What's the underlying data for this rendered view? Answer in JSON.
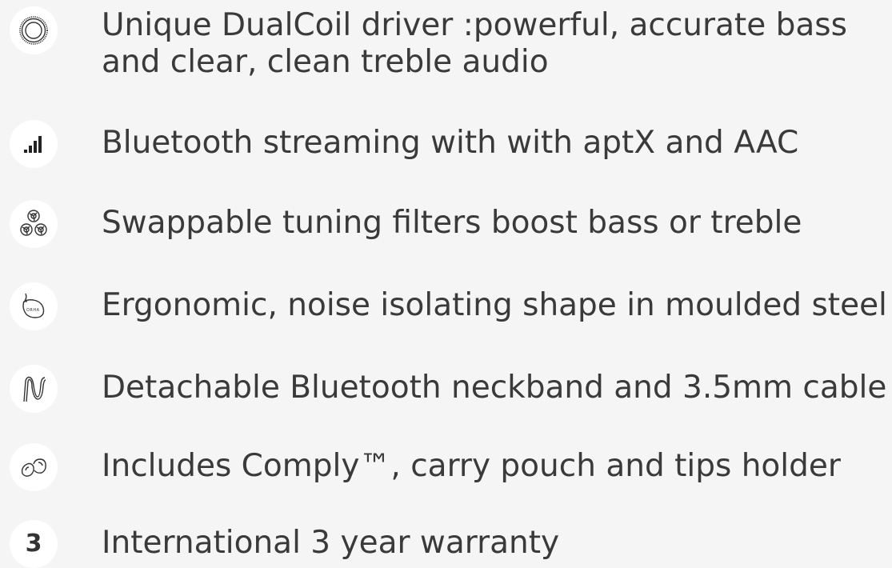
{
  "features": [
    {
      "icon": "driver-coil-icon",
      "text": "Unique DualCoil driver :powerful, accurate bass",
      "text2": "and clear, clean treble audio"
    },
    {
      "icon": "signal-bars-icon",
      "text": "Bluetooth streaming with with aptX and AAC"
    },
    {
      "icon": "tuning-filters-icon",
      "text": "Swappable tuning filters boost bass or treble"
    },
    {
      "icon": "earbud-shape-icon",
      "text": "Ergonomic, noise isolating shape in moulded steel"
    },
    {
      "icon": "cable-icon",
      "text": "Detachable Bluetooth neckband and 3.5mm cable"
    },
    {
      "icon": "ear-tips-icon",
      "text": "Includes Comply™, carry pouch and tips holder"
    },
    {
      "icon": "three-year-icon",
      "icon_glyph": "3",
      "text": "International 3 year warranty"
    }
  ],
  "colors": {
    "background": "#f5f5f5",
    "icon_circle": "#ffffff",
    "text": "#3a3a3a"
  }
}
